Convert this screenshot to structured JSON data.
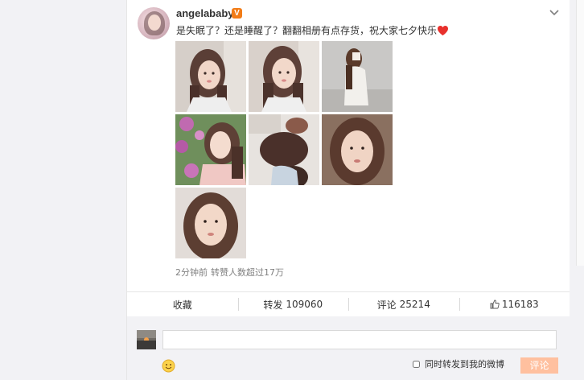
{
  "post": {
    "username": "angelababy",
    "vip_badge": "V",
    "text": "是失眠了？还是睡醒了？翻翻相册有点存货，祝大家七夕快乐",
    "icons": {
      "verified": "vip-badge-icon",
      "menu": "chevron-down-icon",
      "emoji": "heart-icon"
    },
    "photos": [
      {
        "icon": "photo-selfie-pigtails"
      },
      {
        "icon": "photo-selfie-pigtails-closeup"
      },
      {
        "icon": "photo-white-dress-studio"
      },
      {
        "icon": "photo-pink-flowers-selfie"
      },
      {
        "icon": "photo-hair-styling"
      },
      {
        "icon": "photo-portrait-closeup"
      },
      {
        "icon": "photo-portrait-face"
      }
    ],
    "meta": {
      "time": "2分钟前",
      "stats": "转赞人数超过17万"
    }
  },
  "actions": {
    "favorite": {
      "label": "收藏"
    },
    "repost": {
      "label": "转发",
      "count": "109060"
    },
    "comment": {
      "label": "评论",
      "count": "25214"
    },
    "like": {
      "count": "116183"
    }
  },
  "comment_box": {
    "input_value": "",
    "repost_option": "同时转发到我的微博",
    "submit_label": "评论"
  },
  "colors": {
    "accent_orange": "#f27c17",
    "heart": "#e8302c",
    "button_disabled": "#ffc09f"
  }
}
